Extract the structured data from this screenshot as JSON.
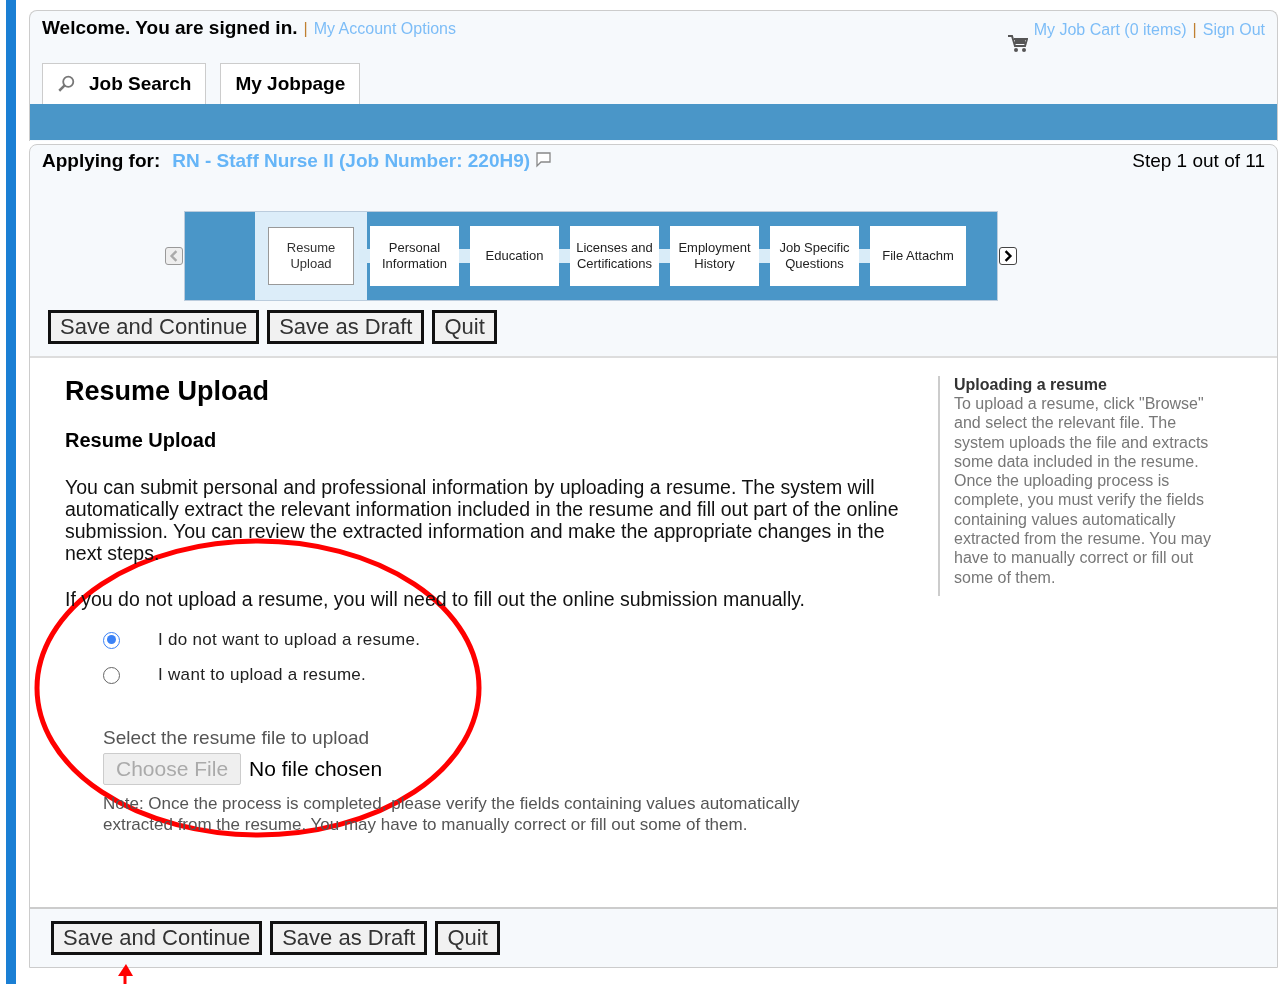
{
  "header": {
    "welcome": "Welcome. You are signed in.",
    "separator": "|",
    "account_link": "My Account Options",
    "cart_link": "My Job Cart (0 items)",
    "cart_separator": "|",
    "sign_out": "Sign Out"
  },
  "nav_tabs": [
    {
      "label": "Job Search",
      "kind": "search"
    },
    {
      "label": "My Jobpage",
      "kind": "plain"
    }
  ],
  "application": {
    "applying_label": "Applying for:",
    "job_title": "RN - Staff Nurse II (Job Number: 220H9)",
    "step_text": "Step 1 out of 11"
  },
  "stepper": {
    "prev_disabled": true,
    "next_disabled": false,
    "steps": [
      {
        "label": "Resume Upload",
        "selected": true
      },
      {
        "label": "Personal Information",
        "selected": false
      },
      {
        "label": "Education",
        "selected": false
      },
      {
        "label": "Licenses and Certifications",
        "selected": false
      },
      {
        "label": "Employment History",
        "selected": false
      },
      {
        "label": "Job Specific Questions",
        "selected": false
      },
      {
        "label": "File Attachm",
        "selected": false
      }
    ]
  },
  "top_buttons": [
    "Save and Continue",
    "Save as Draft",
    "Quit"
  ],
  "content": {
    "page_title": "Resume Upload",
    "section_title": "Resume Upload",
    "intro": "You can submit personal and professional information by uploading a resume. The system will automatically extract the relevant information included in the resume and fill out part of the online submission. You can review the extracted information and make the appropriate changes in the next steps.",
    "manual_note": "If you do not upload a resume, you will need to fill out the online submission manually.",
    "options": [
      {
        "label": "I do not want to upload a resume.",
        "selected": true
      },
      {
        "label": "I want to upload a resume.",
        "selected": false
      }
    ],
    "file_label": "Select the resume file to upload",
    "file_button": "Choose File",
    "file_button_disabled": true,
    "file_status": "No file chosen",
    "note": "Note: Once the process is completed, please verify the fields containing values automatically extracted from the resume. You may have to manually correct or fill out some of them."
  },
  "help": {
    "title": "Uploading a resume",
    "text": "To upload a resume, click \"Browse\" and select the relevant file. The system uploads the file and extracts some data included in the resume. Once the uploading process is complete, you must verify the fields containing values automatically extracted from the resume. You may have to manually correct or fill out some of them."
  },
  "bottom_buttons": [
    "Save and Continue",
    "Save as Draft",
    "Quit"
  ]
}
